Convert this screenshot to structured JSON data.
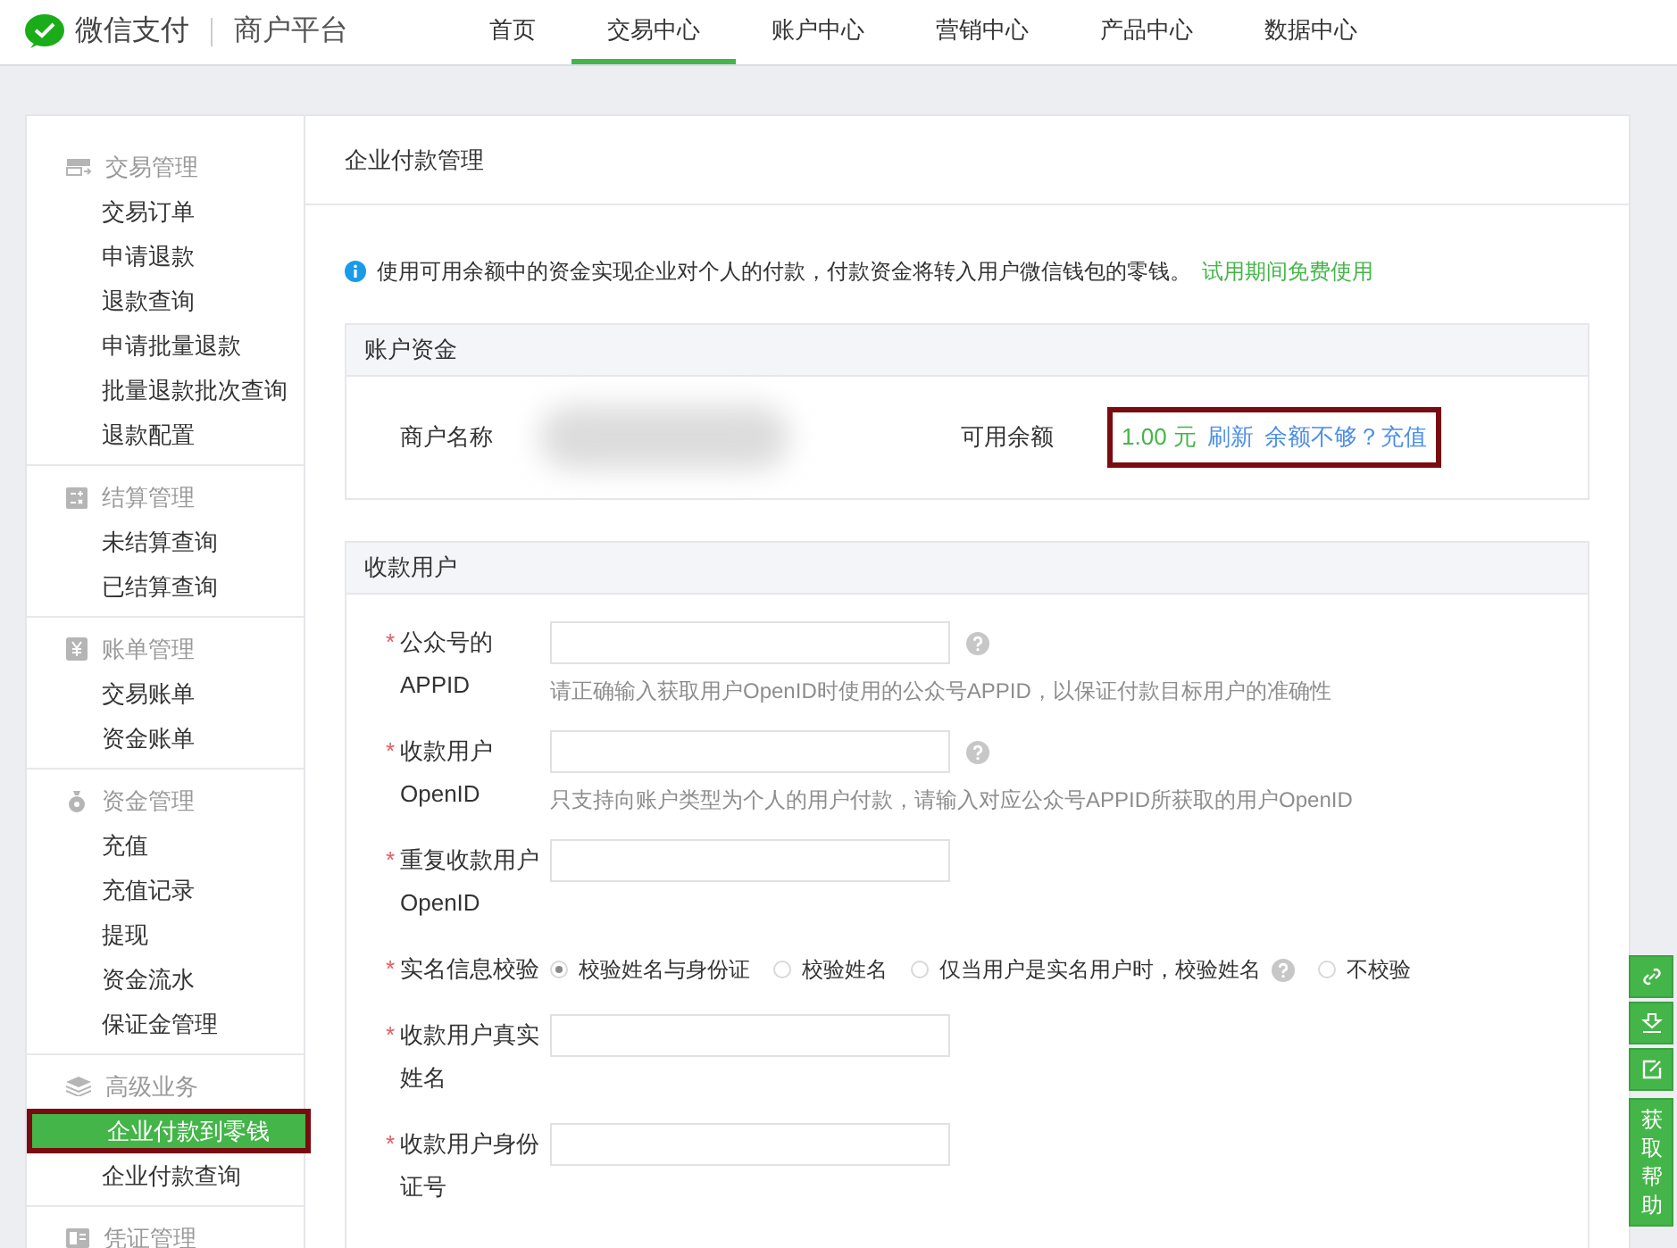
{
  "brand": {
    "name": "微信支付",
    "subtitle": "商户平台"
  },
  "nav": [
    {
      "label": "首页",
      "selected": false
    },
    {
      "label": "交易中心",
      "selected": true
    },
    {
      "label": "账户中心",
      "selected": false
    },
    {
      "label": "营销中心",
      "selected": false
    },
    {
      "label": "产品中心",
      "selected": false
    },
    {
      "label": "数据中心",
      "selected": false
    }
  ],
  "sidebar": [
    {
      "title": "交易管理",
      "kind": "trade",
      "items": [
        {
          "label": "交易订单",
          "selected": false,
          "highlighted": false
        },
        {
          "label": "申请退款",
          "selected": false,
          "highlighted": false
        },
        {
          "label": "退款查询",
          "selected": false,
          "highlighted": false
        },
        {
          "label": "申请批量退款",
          "selected": false,
          "highlighted": false
        },
        {
          "label": "批量退款批次查询",
          "selected": false,
          "highlighted": false
        },
        {
          "label": "退款配置",
          "selected": false,
          "highlighted": false
        }
      ]
    },
    {
      "title": "结算管理",
      "kind": "settle",
      "items": [
        {
          "label": "未结算查询",
          "selected": false,
          "highlighted": false
        },
        {
          "label": "已结算查询",
          "selected": false,
          "highlighted": false
        }
      ]
    },
    {
      "title": "账单管理",
      "kind": "bill",
      "items": [
        {
          "label": "交易账单",
          "selected": false,
          "highlighted": false
        },
        {
          "label": "资金账单",
          "selected": false,
          "highlighted": false
        }
      ]
    },
    {
      "title": "资金管理",
      "kind": "fund",
      "items": [
        {
          "label": "充值",
          "selected": false,
          "highlighted": false
        },
        {
          "label": "充值记录",
          "selected": false,
          "highlighted": false
        },
        {
          "label": "提现",
          "selected": false,
          "highlighted": false
        },
        {
          "label": "资金流水",
          "selected": false,
          "highlighted": false
        },
        {
          "label": "保证金管理",
          "selected": false,
          "highlighted": false
        }
      ]
    },
    {
      "title": "高级业务",
      "kind": "advanced",
      "items": [
        {
          "label": "企业付款到零钱",
          "selected": true,
          "highlighted": true
        },
        {
          "label": "企业付款查询",
          "selected": false,
          "highlighted": false
        }
      ]
    },
    {
      "title": "凭证管理",
      "kind": "voucher"
    }
  ],
  "page_title": "企业付款管理",
  "notice": {
    "text": "使用可用余额中的资金实现企业对个人的付款，付款资金将转入用户微信钱包的零钱。",
    "link": "试用期间免费使用"
  },
  "account_panel": {
    "title": "账户资金",
    "merchant_label": "商户名称",
    "balance_label": "可用余额",
    "balance": "1.00 元",
    "refresh": "刷新",
    "topup": "余额不够？充值",
    "highlighted": true
  },
  "payee_panel": {
    "title": "收款用户",
    "fields": [
      {
        "kind": "input",
        "required_mark": "*",
        "label": "公众号的APPID",
        "help": true,
        "hint": "请正确输入获取用户OpenID时使用的公众号APPID，以保证付款目标用户的准确性"
      },
      {
        "kind": "input",
        "required_mark": "*",
        "label": "收款用户OpenID",
        "help": true,
        "hint": "只支持向账户类型为个人的用户付款，请输入对应公众号APPID所获取的用户OpenID"
      },
      {
        "kind": "input",
        "required_mark": "*",
        "label": "重复收款用户OpenID",
        "help": false
      },
      {
        "kind": "radio",
        "required_mark": "*",
        "label": "实名信息校验",
        "options": [
          {
            "label": "校验姓名与身份证",
            "selected": true,
            "help": false
          },
          {
            "label": "校验姓名",
            "selected": false,
            "help": false
          },
          {
            "label": "仅当用户是实名用户时，校验姓名",
            "selected": false,
            "help": true
          },
          {
            "label": "不校验",
            "selected": false,
            "help": false
          }
        ]
      },
      {
        "kind": "input",
        "required_mark": "*",
        "label": "收款用户真实姓名",
        "help": false
      },
      {
        "kind": "input",
        "required_mark": "*",
        "label": "收款用户身份证号",
        "help": false
      }
    ]
  },
  "side_tools": {
    "tools": [
      {
        "kind": "link"
      },
      {
        "kind": "download"
      },
      {
        "kind": "edit"
      }
    ],
    "help_button": "获取帮助"
  }
}
